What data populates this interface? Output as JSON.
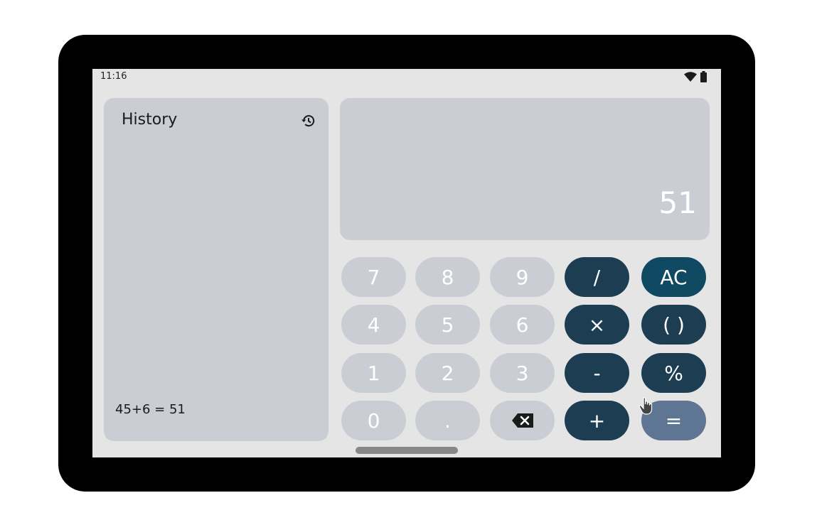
{
  "status_bar": {
    "time": "11:16",
    "wifi_icon": "wifi-icon",
    "battery_icon": "battery-icon"
  },
  "history": {
    "title": "History",
    "icon": "history-icon",
    "entries": [
      "45+6 = 51"
    ]
  },
  "display": {
    "value": "51"
  },
  "keypad": {
    "row1": [
      "7",
      "8",
      "9",
      "/",
      "AC"
    ],
    "row2": [
      "4",
      "5",
      "6",
      "×",
      "( )"
    ],
    "row3": [
      "1",
      "2",
      "3",
      "-",
      "%"
    ],
    "row4": [
      "0",
      ".",
      "backspace-icon",
      "+",
      "="
    ]
  },
  "colors": {
    "screen_bg": "#e5e5e5",
    "panel_bg": "#caced4",
    "operator_key": "#1d3e52",
    "clear_key": "#0f4a62",
    "equals_key": "#5f7594",
    "device_frame": "#000000"
  }
}
